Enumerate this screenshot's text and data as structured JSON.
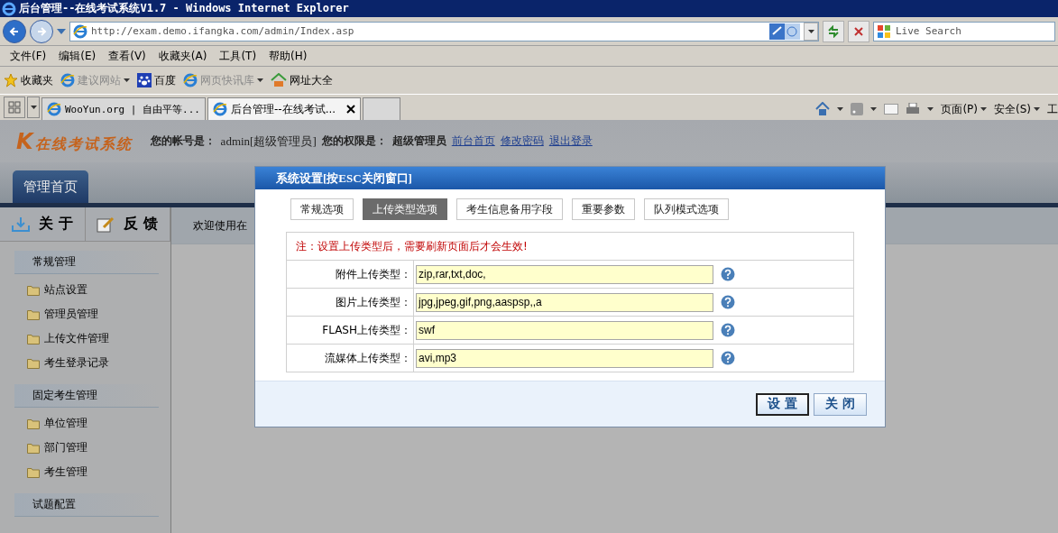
{
  "window": {
    "title": "后台管理--在线考试系统V1.7 - Windows Internet Explorer"
  },
  "address_bar": {
    "url": "http://exam.demo.ifangka.com/admin/Index.asp",
    "search_placeholder": "Live Search"
  },
  "menu": [
    "文件(F)",
    "编辑(E)",
    "查看(V)",
    "收藏夹(A)",
    "工具(T)",
    "帮助(H)"
  ],
  "favorites": [
    {
      "label": "收藏夹",
      "kind": "star",
      "disabled": false,
      "dropdown": false
    },
    {
      "label": "建议网站",
      "kind": "ie",
      "disabled": true,
      "dropdown": true
    },
    {
      "label": "百度",
      "kind": "paw",
      "disabled": false,
      "dropdown": false
    },
    {
      "label": "网页快讯库",
      "kind": "ie",
      "disabled": true,
      "dropdown": true
    },
    {
      "label": "网址大全",
      "kind": "house",
      "disabled": false,
      "dropdown": false
    }
  ],
  "browser_tabs": [
    {
      "label": "WooYun.org | 自由平等...",
      "selected": false
    },
    {
      "label": "后台管理--在线考试...",
      "selected": true
    }
  ],
  "command_bar": [
    "页面(P)",
    "安全(S)",
    "工"
  ],
  "app": {
    "logo_mark": "K",
    "logo_text": "在线考试系统",
    "account_label": "您的帐号是：",
    "account": "admin[超级管理员]",
    "permission_label": "您的权限是：",
    "permission": "超级管理员",
    "links": [
      "前台首页",
      "修改密码",
      "退出登录"
    ],
    "nav_tab": "管理首页",
    "quick_buttons": [
      {
        "label": "关 于",
        "kind": "download"
      },
      {
        "label": "反 馈",
        "kind": "edit"
      }
    ],
    "welcome": "欢迎使用在",
    "sidebar": [
      {
        "title": "常规管理",
        "items": [
          "站点设置",
          "管理员管理",
          "上传文件管理",
          "考生登录记录"
        ]
      },
      {
        "title": "固定考生管理",
        "items": [
          "单位管理",
          "部门管理",
          "考生管理"
        ]
      },
      {
        "title": "试题配置"
      }
    ]
  },
  "dialog": {
    "title": "系统设置[按ESC关闭窗口]",
    "tabs": [
      {
        "label": "常规选项",
        "selected": false
      },
      {
        "label": "上传类型选项",
        "selected": true
      },
      {
        "label": "考生信息备用字段",
        "selected": false
      },
      {
        "label": "重要参数",
        "selected": false
      },
      {
        "label": "队列模式选项",
        "selected": false
      }
    ],
    "note": "注：设置上传类型后，需要刷新页面后才会生效!",
    "fields": [
      {
        "label": "附件上传类型：",
        "value": "zip,rar,txt,doc,"
      },
      {
        "label": "图片上传类型：",
        "value": "jpg,jpeg,gif,png,aaspsp,,a"
      },
      {
        "label": "FLASH上传类型：",
        "value": "swf"
      },
      {
        "label": "流媒体上传类型：",
        "value": "avi,mp3"
      }
    ],
    "buttons": [
      "设 置",
      "关 闭"
    ]
  }
}
